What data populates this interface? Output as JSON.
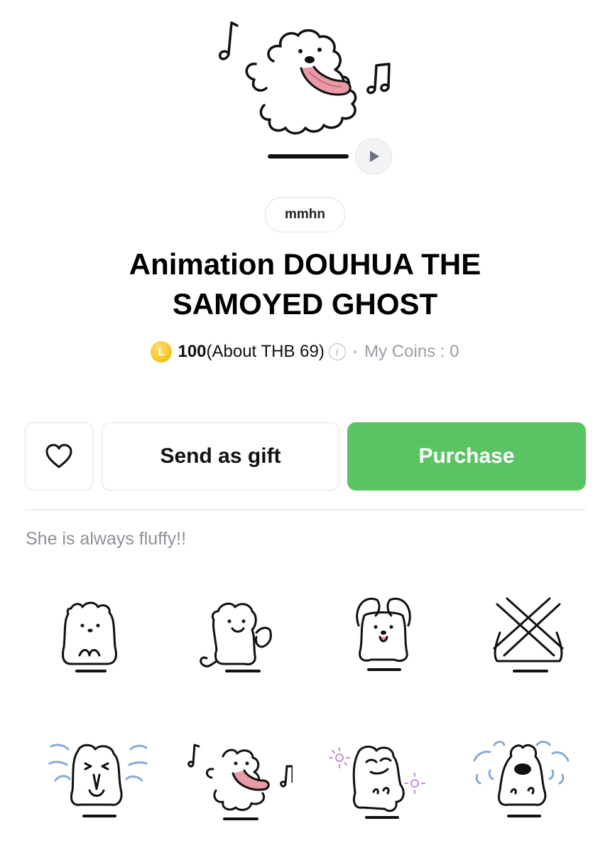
{
  "hero": {
    "sticker": "samoyed-ghost-dancing-tongue-out",
    "play_icon": "play-icon"
  },
  "author": "mmhn",
  "title_line1": "Animation DOUHUA THE",
  "title_line2": "SAMOYED GHOST",
  "price": {
    "coin_letter": "L",
    "amount": "100",
    "about": "(About THB 69)",
    "info_icon_glyph": "i",
    "separator": "•",
    "my_coins": "My Coins : 0"
  },
  "actions": {
    "favorite_icon": "heart-icon",
    "gift_label": "Send as gift",
    "purchase_label": "Purchase"
  },
  "description": "She is always fluffy!!",
  "stickers": [
    {
      "name": "sticker-sitting"
    },
    {
      "name": "sticker-thumbs-up"
    },
    {
      "name": "sticker-heart-arms"
    },
    {
      "name": "sticker-crossed-arms"
    },
    {
      "name": "sticker-please"
    },
    {
      "name": "sticker-dancing"
    },
    {
      "name": "sticker-sparkle-smirk"
    },
    {
      "name": "sticker-crying"
    }
  ],
  "colors": {
    "purchase": "#5ac463",
    "coin": "#f2c21b",
    "muted_text": "#9a9ea5"
  }
}
